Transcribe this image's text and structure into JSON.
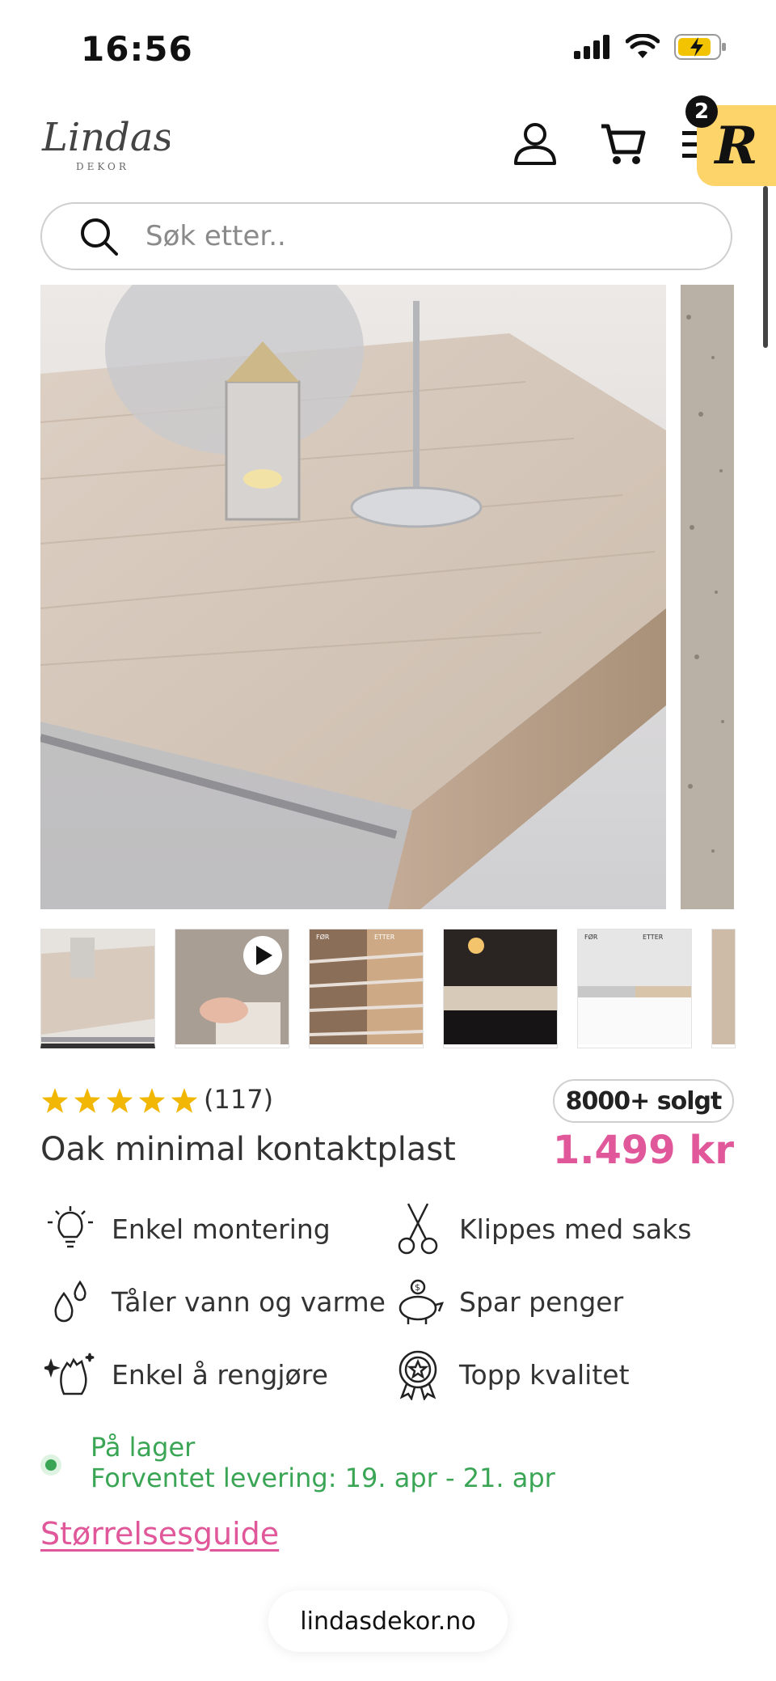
{
  "status_bar": {
    "time": "16:56"
  },
  "header": {
    "logo_text": "Lindas",
    "logo_subtext": "DEKOR",
    "cart_count": "2",
    "widget_letter": "R"
  },
  "search": {
    "placeholder": "Søk etter.."
  },
  "product": {
    "rating_count": "(117)",
    "sold_badge": "8000+ solgt",
    "title": "Oak minimal kontaktplast",
    "price": "1.499 kr",
    "rating_stars": 5
  },
  "features": [
    {
      "label": "Enkel montering",
      "icon": "lightbulb-icon"
    },
    {
      "label": "Klippes med saks",
      "icon": "scissors-icon"
    },
    {
      "label": "Tåler vann og varme",
      "icon": "water-drops-icon"
    },
    {
      "label": "Spar penger",
      "icon": "piggy-bank-icon"
    },
    {
      "label": "Enkel å rengjøre",
      "icon": "clean-hand-icon"
    },
    {
      "label": "Topp kvalitet",
      "icon": "quality-badge-icon"
    }
  ],
  "thumbnails": {
    "before_label": "FØR",
    "after_label": "ETTER"
  },
  "stock": {
    "status": "På lager",
    "delivery": "Forventet levering: 19. apr - 21. apr"
  },
  "size_guide": "Størrelsesguide",
  "browser": {
    "url": "lindasdekor.no"
  },
  "colors": {
    "accent_pink": "#e0579a",
    "stock_green": "#3aa655",
    "star_yellow": "#f2b705",
    "widget_yellow": "#fdd46a"
  }
}
